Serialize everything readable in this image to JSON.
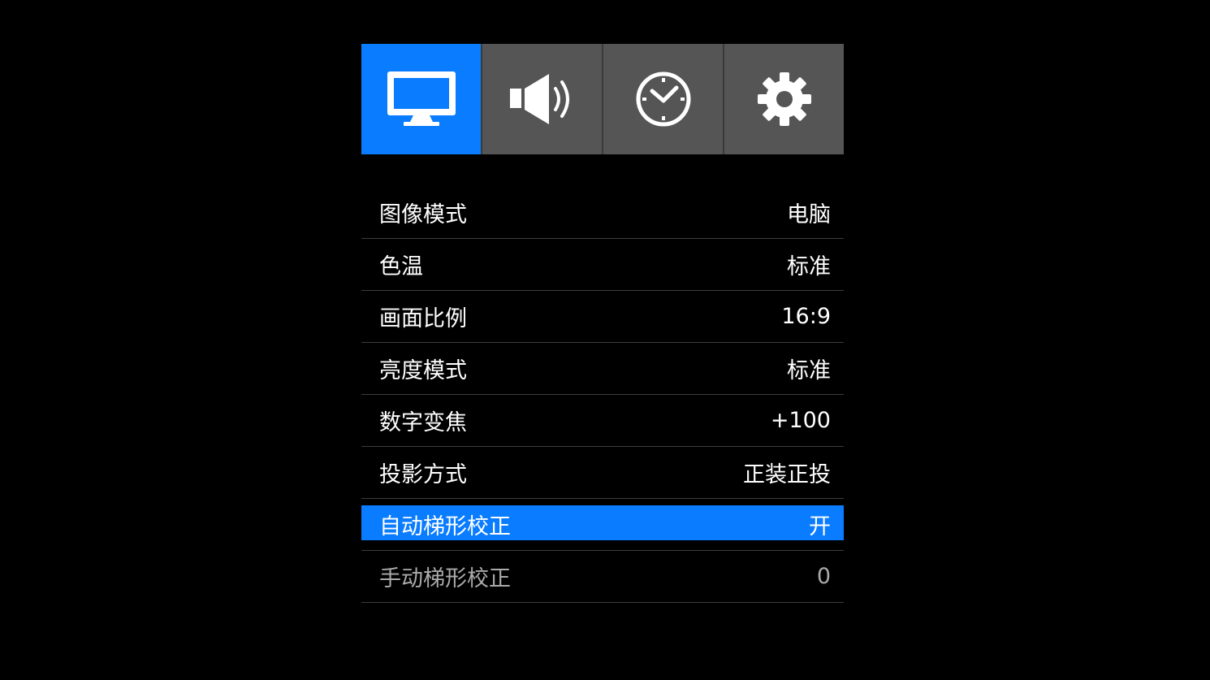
{
  "tabs": [
    {
      "id": "picture",
      "icon": "monitor-icon",
      "active": true
    },
    {
      "id": "sound",
      "icon": "speaker-icon",
      "active": false
    },
    {
      "id": "time",
      "icon": "clock-icon",
      "active": false
    },
    {
      "id": "settings",
      "icon": "gear-icon",
      "active": false
    }
  ],
  "colors": {
    "accent": "#0a7cff",
    "tab_inactive": "#555555",
    "background": "#000000",
    "text": "#ffffff",
    "text_dim": "#aaaaaa"
  },
  "menu": {
    "items": [
      {
        "label": "图像模式",
        "value": "电脑"
      },
      {
        "label": "色温",
        "value": "标准"
      },
      {
        "label": "画面比例",
        "value": "16:9"
      },
      {
        "label": "亮度模式",
        "value": "标准"
      },
      {
        "label": "数字变焦",
        "value": "+100"
      },
      {
        "label": "投影方式",
        "value": "正装正投"
      },
      {
        "label": "自动梯形校正",
        "value": "开",
        "selected": true
      },
      {
        "label": "手动梯形校正",
        "value": "0",
        "disabled": true
      }
    ]
  }
}
